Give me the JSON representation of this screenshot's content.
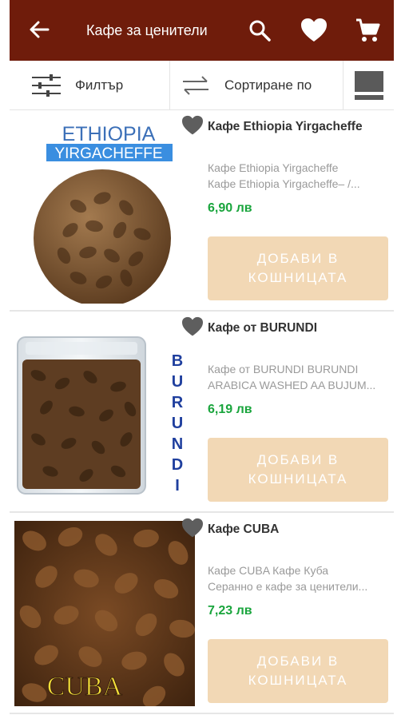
{
  "header": {
    "title": "Кафе за ценители",
    "icons": [
      "back-arrow-icon",
      "search-icon",
      "heart-icon",
      "cart-icon"
    ]
  },
  "toolbar": {
    "filter_label": "Филтър",
    "sort_label": "Сортиране по",
    "icons": [
      "filter-sliders-icon",
      "sort-arrows-icon",
      "view-toggle-icon"
    ]
  },
  "products": [
    {
      "name": "Кафе Ethiopia Yirgacheffe",
      "desc_line1": "Кафе Ethiopia Yirgacheffe",
      "desc_line2": "Кафе Ethiopia Yirgacheffe– /...",
      "price": "6,90 лв",
      "image_text_top": "ETHIOPIA",
      "image_text_bottom": "YIRGACHEFFE",
      "button_line1": "ДОБАВИ В",
      "button_line2": "КОШНИЦАТА"
    },
    {
      "name": "Кафе от BURUNDI",
      "desc_line1": "Кафе от BURUNDI BURUNDI",
      "desc_line2": "ARABICA WASHED AA BUJUM...",
      "price": "6,19 лв",
      "image_text": "BURUNDI",
      "button_line1": "ДОБАВИ В",
      "button_line2": "КОШНИЦАТА"
    },
    {
      "name": "Кафе CUBA",
      "desc_line1": "Кафе CUBA  Кафе Куба",
      "desc_line2": "Серанно е кафе за ценители...",
      "price": "7,23 лв",
      "image_text": "CUBA",
      "button_line1": "ДОБАВИ В",
      "button_line2": "КОШНИЦАТА"
    }
  ],
  "colors": {
    "header_bg": "#6f1c0b",
    "price": "#1aa53d",
    "add_button": "#f2d8b5"
  }
}
